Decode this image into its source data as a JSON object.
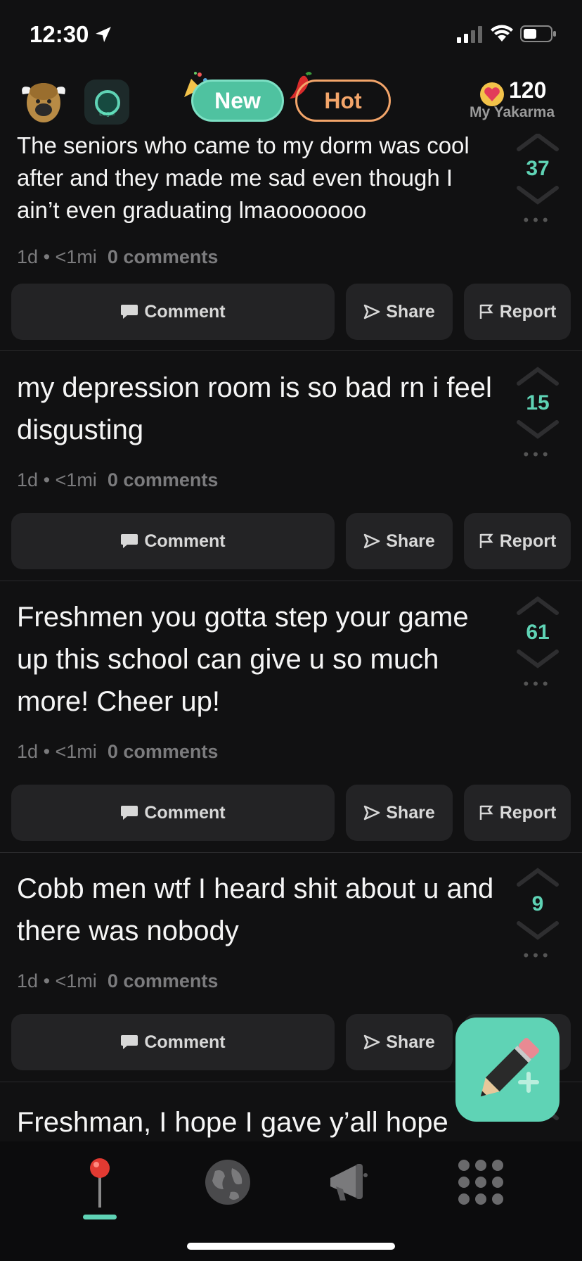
{
  "status_bar": {
    "time": "12:30"
  },
  "header": {
    "tab_new": "New",
    "tab_hot": "Hot",
    "karma_value": "120",
    "karma_label": "My Yakarma",
    "herd_icon_text": "Legal"
  },
  "posts": [
    {
      "text": "The seniors who came to my dorm was cool after and they made me sad even though I ain’t even graduating lmaooooooo",
      "votes": "37",
      "age": "1d",
      "distance": "<1mi",
      "comments": "0 comments"
    },
    {
      "text": "my depression room is so bad rn i feel disgusting",
      "votes": "15",
      "age": "1d",
      "distance": "<1mi",
      "comments": "0 comments"
    },
    {
      "text": "Freshmen you gotta step your game up this school can give u so much more! Cheer up!",
      "votes": "61",
      "age": "1d",
      "distance": "<1mi",
      "comments": "0 comments"
    },
    {
      "text": "Cobb men wtf I heard shit about u and there was nobody",
      "votes": "9",
      "age": "1d",
      "distance": "<1mi",
      "comments": "0 comments"
    },
    {
      "text": "Freshman, I hope I gave y’all hope"
    }
  ],
  "actions": {
    "comment": "Comment",
    "share": "Share",
    "report": "Report",
    "separator": "•"
  },
  "colors": {
    "accent": "#5fd3b5",
    "hot": "#f3a56a",
    "background": "#111112",
    "button": "#232325"
  },
  "tabbar": {
    "items": [
      "pin-icon",
      "globe-icon",
      "megaphone-icon",
      "grid-icon"
    ],
    "active": 0
  }
}
